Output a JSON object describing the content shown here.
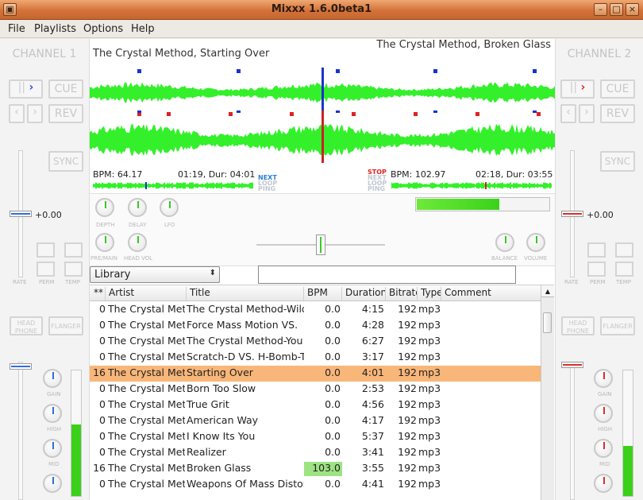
{
  "window": {
    "title": "Mixxx 1.6.0beta1"
  },
  "menu": [
    "File",
    "Playlists",
    "Options",
    "Help"
  ],
  "channel1": {
    "title": "CHANNEL 1",
    "cue_label": "CUE",
    "rev_label": "REV",
    "sync_label": "SYNC",
    "pitch_value": "+0.00",
    "rate_label": "RATE",
    "perm_label": "PERM",
    "temp_label": "TEMP",
    "headphone_label": "HEAD PHONE",
    "flanger_label": "FLANGER",
    "gain_label": "GAIN",
    "high_label": "HIGH",
    "mid_label": "MID",
    "vu_level": 0.57
  },
  "channel2": {
    "title": "CHANNEL 2",
    "cue_label": "CUE",
    "rev_label": "REV",
    "sync_label": "SYNC",
    "pitch_value": "+0.00",
    "rate_label": "RATE",
    "perm_label": "PERM",
    "temp_label": "TEMP",
    "headphone_label": "HEAD PHONE",
    "flanger_label": "FLANGER",
    "gain_label": "GAIN",
    "high_label": "HIGH",
    "mid_label": "MID",
    "vu_level": 0.4
  },
  "deck1": {
    "track": "The Crystal Method, Starting Over",
    "bpm": "BPM:  64.17",
    "time": "01:19, Dur: 04:01",
    "modes": [
      "NEXT",
      "LOOP",
      "PING"
    ]
  },
  "deck2": {
    "track": "The Crystal Method, Broken Glass",
    "bpm": "BPM: 102.97",
    "time": "02:18, Dur: 03:55",
    "modes": [
      "STOP",
      "NEXT",
      "LOOP",
      "PING"
    ]
  },
  "mixer": {
    "knobs": [
      "DEPTH",
      "DELAY",
      "LFO",
      "PRE/MAIN",
      "HEAD VOL",
      "BALANCE",
      "VOLUME"
    ],
    "master_level": 0.62
  },
  "library": {
    "source": "Library",
    "search_value": "",
    "columns": [
      "**",
      "Artist",
      "Title",
      "BPM",
      "Duration",
      "Bitrate",
      "Type",
      "Comment"
    ],
    "rows": [
      {
        "n": "0",
        "artist": "The Crystal Method",
        "title": "The Crystal Method-Wild",
        "bpm": "0.0",
        "dur": "4:15",
        "br": "192",
        "type": "mp3"
      },
      {
        "n": "0",
        "artist": "The Crystal Method",
        "title": "Force Mass Motion VS.",
        "bpm": "0.0",
        "dur": "4:28",
        "br": "192",
        "type": "mp3"
      },
      {
        "n": "0",
        "artist": "The Crystal Method",
        "title": "The Crystal Method-You",
        "bpm": "0.0",
        "dur": "6:27",
        "br": "192",
        "type": "mp3"
      },
      {
        "n": "0",
        "artist": "The Crystal Method",
        "title": "Scratch-D VS. H-Bomb-T",
        "bpm": "0.0",
        "dur": "3:17",
        "br": "192",
        "type": "mp3"
      },
      {
        "n": "16",
        "artist": "The Crystal Method",
        "title": "Starting Over",
        "bpm": "0.0",
        "dur": "4:01",
        "br": "192",
        "type": "mp3",
        "selected": true
      },
      {
        "n": "0",
        "artist": "The Crystal Method",
        "title": "Born Too Slow",
        "bpm": "0.0",
        "dur": "2:53",
        "br": "192",
        "type": "mp3"
      },
      {
        "n": "0",
        "artist": "The Crystal Method",
        "title": "True Grit",
        "bpm": "0.0",
        "dur": "4:56",
        "br": "192",
        "type": "mp3"
      },
      {
        "n": "0",
        "artist": "The Crystal Method",
        "title": "American Way",
        "bpm": "0.0",
        "dur": "4:17",
        "br": "192",
        "type": "mp3"
      },
      {
        "n": "0",
        "artist": "The Crystal Method",
        "title": "I Know Its You",
        "bpm": "0.0",
        "dur": "5:37",
        "br": "192",
        "type": "mp3"
      },
      {
        "n": "0",
        "artist": "The Crystal Method",
        "title": "Realizer",
        "bpm": "0.0",
        "dur": "3:41",
        "br": "192",
        "type": "mp3"
      },
      {
        "n": "16",
        "artist": "The Crystal Method",
        "title": "Broken Glass",
        "bpm": "103.0",
        "dur": "3:55",
        "br": "192",
        "type": "mp3",
        "bpm_highlight": true
      },
      {
        "n": "0",
        "artist": "The Crystal Method",
        "title": "Weapons Of Mass Distortion",
        "bpm": "0.0",
        "dur": "4:41",
        "br": "192",
        "type": "mp3"
      }
    ]
  },
  "colors": {
    "wave": "#33f02b",
    "play_marker_1": "#1a33cc",
    "play_marker_2": "#cc2222",
    "selection": "#f8b679",
    "titlebar": "#d2733a"
  }
}
